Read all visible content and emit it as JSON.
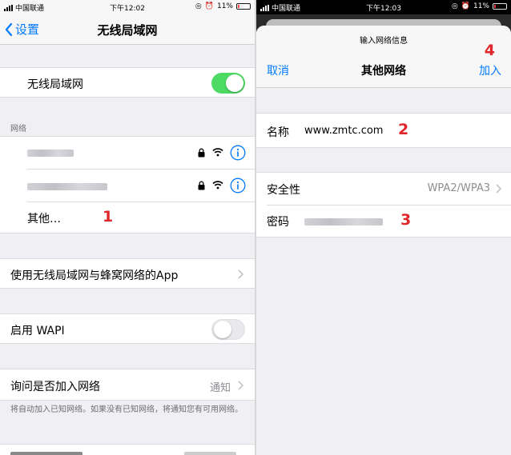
{
  "left": {
    "status": {
      "carrier": "中国联通",
      "time": "下午12:02",
      "battery": "11%"
    },
    "nav": {
      "back_label": "设置",
      "title": "无线局域网"
    },
    "wifi_row": {
      "label": "无线局域网",
      "enabled": true
    },
    "networks_header": "网络",
    "other_label": "其他…",
    "step1": "1",
    "apps_row": {
      "label": "使用无线局域网与蜂窝网络的App"
    },
    "wapi_row": {
      "label": "启用 WAPI",
      "enabled": false
    },
    "ask_row": {
      "label": "询问是否加入网络",
      "value": "通知"
    },
    "ask_note": "将自动加入已知网络。如果没有已知网络，将通知您有可用网络。"
  },
  "right": {
    "status": {
      "carrier": "中国联通",
      "time": "下午12:03",
      "battery": "11%"
    },
    "prompt": "输入网络信息",
    "cancel_label": "取消",
    "title": "其他网络",
    "join_label": "加入",
    "step4": "4",
    "name_row": {
      "label": "名称",
      "value": "www.zmtc.com"
    },
    "step2": "2",
    "security_row": {
      "label": "安全性",
      "value": "WPA2/WPA3"
    },
    "password_row": {
      "label": "密码"
    },
    "step3": "3"
  },
  "colors": {
    "accent": "#007aff",
    "toggle_on": "#4cd964",
    "annotation": "#e0262b"
  }
}
